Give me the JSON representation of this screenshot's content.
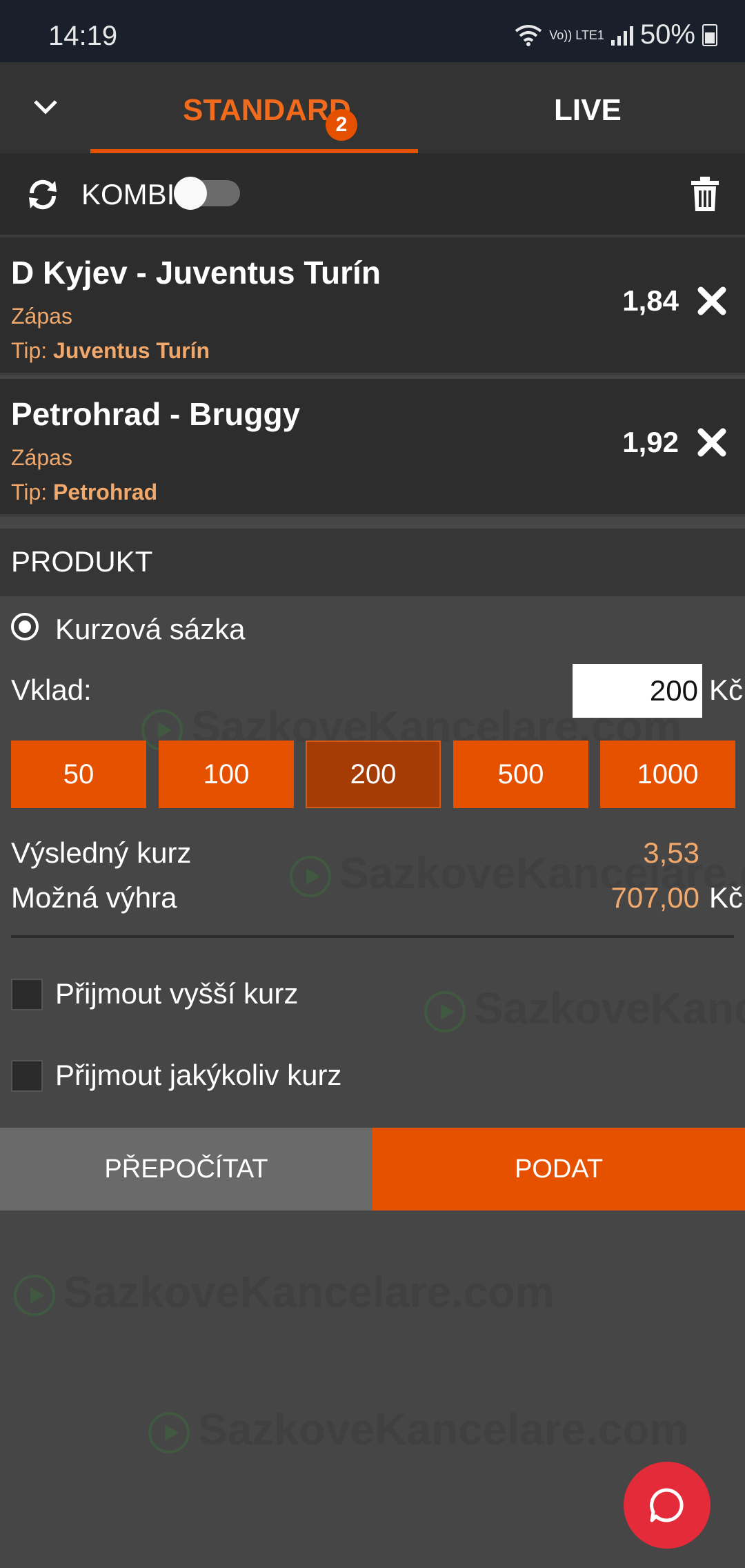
{
  "status_bar": {
    "time": "14:19",
    "network": "Vo)) LTE1",
    "battery": "50%"
  },
  "tabs": [
    {
      "label": "STANDARD",
      "badge": "2",
      "active": true
    },
    {
      "label": "LIVE",
      "active": false
    }
  ],
  "kombi": {
    "label": "KOMBI",
    "enabled": false
  },
  "bets": [
    {
      "match": "D Kyjev - Juventus Turín",
      "market": "Zápas",
      "tip_prefix": "Tip:",
      "tip": "Juventus Turín",
      "odd": "1,84"
    },
    {
      "match": "Petrohrad - Bruggy",
      "market": "Zápas",
      "tip_prefix": "Tip:",
      "tip": "Petrohrad",
      "odd": "1,92"
    }
  ],
  "produkt": {
    "title": "PRODUKT",
    "option": "Kurzová sázka",
    "vklad_label": "Vklad:",
    "vklad_value": "200",
    "currency": "Kč",
    "quick_amounts": [
      "50",
      "100",
      "200",
      "500",
      "1000"
    ],
    "selected_quick": "200"
  },
  "summary": {
    "total_odds_label": "Výsledný kurz",
    "total_odds": "3,53",
    "win_label": "Možná výhra",
    "win_value": "707,00",
    "currency": "Kč"
  },
  "options": [
    {
      "label": "Přijmout vyšší kurz",
      "checked": false
    },
    {
      "label": "Přijmout jakýkoliv kurz",
      "checked": false
    }
  ],
  "actions": {
    "recalc": "PŘEPOČÍTAT",
    "submit": "PODAT"
  },
  "watermark": "SazkoveKancelare.com",
  "colors": {
    "accent": "#e65100",
    "tip": "#f0a86c",
    "chat": "#e32b3a"
  }
}
